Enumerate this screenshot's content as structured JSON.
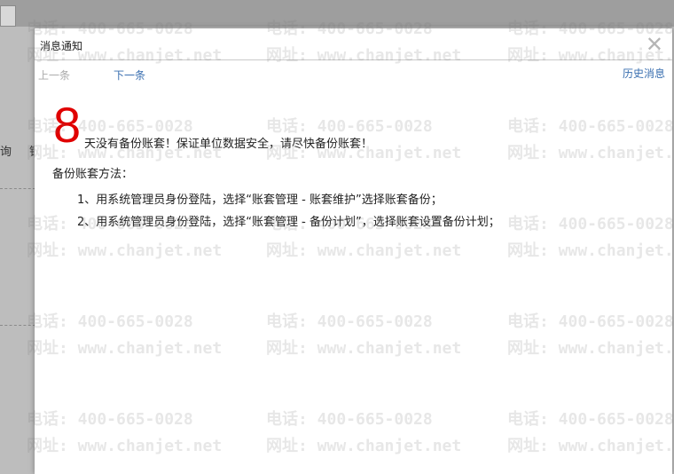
{
  "dialog": {
    "title": "消息通知",
    "close_glyph": "✕"
  },
  "nav": {
    "prev": "上一条",
    "next": "下一条",
    "history": "历史消息"
  },
  "message": {
    "days": "8",
    "main_text": "天没有备份账套！保证单位数据安全，请尽快备份账套！",
    "method_title": "备份账套方法：",
    "steps": [
      "1、用系统管理员身份登陆，选择“账套管理 - 账套维护”选择账套备份；",
      "2、用系统管理员身份登陆，选择“账套管理 - 备份计划”，选择账套设置备份计划；"
    ]
  },
  "watermark": {
    "phone": "电话: 400-665-0028",
    "site": "网址: www.chanjet.net"
  },
  "background": {
    "char1": "询",
    "char2": "销"
  }
}
